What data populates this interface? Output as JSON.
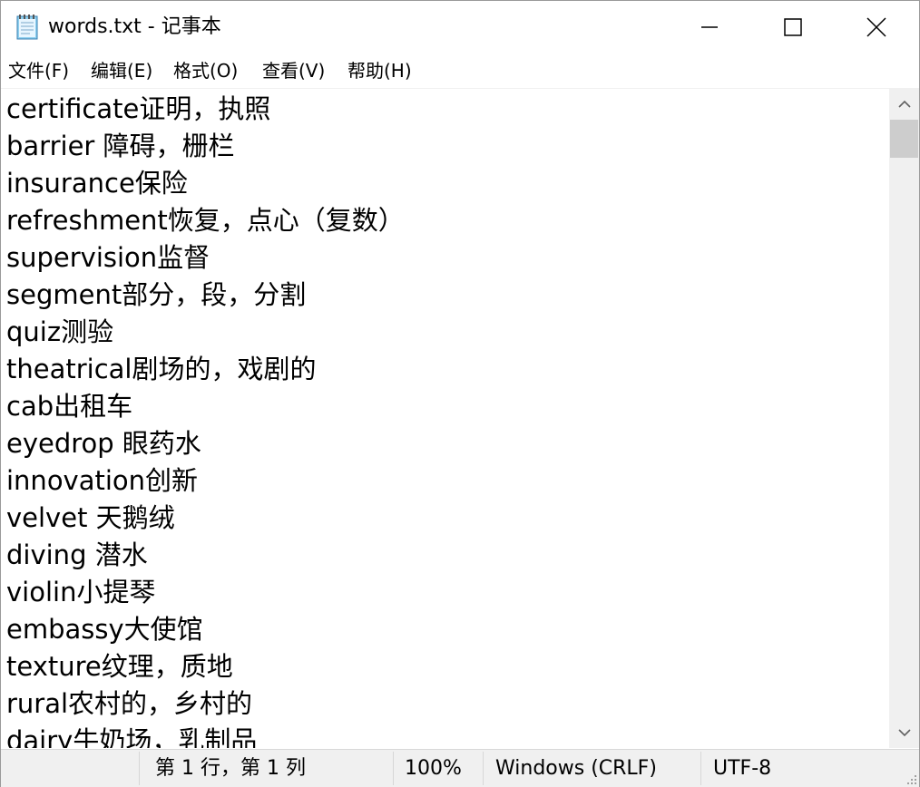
{
  "window": {
    "title": "words.txt - 记事本",
    "icon": "notepad-icon"
  },
  "menu": {
    "file": "文件(F)",
    "edit": "编辑(E)",
    "format": "格式(O)",
    "view": "查看(V)",
    "help": "帮助(H)"
  },
  "editor": {
    "lines": [
      "certificate证明，执照",
      "barrier 障碍，栅栏",
      "insurance保险",
      "refreshment恢复，点心（复数）",
      "supervision监督",
      "segment部分，段，分割",
      "quiz测验",
      "theatrical剧场的，戏剧的",
      "cab出租车",
      "eyedrop 眼药水",
      "innovation创新",
      "velvet 天鹅绒",
      "diving 潜水",
      "violin小提琴",
      "embassy大使馆",
      "texture纹理，质地",
      "rural农村的，乡村的",
      "dairy牛奶场，乳制品"
    ]
  },
  "status": {
    "position": "第 1 行，第 1 列",
    "zoom": "100%",
    "line_ending": "Windows (CRLF)",
    "encoding": "UTF-8"
  },
  "colors": {
    "scrollbar_track": "#f0f0f0",
    "scrollbar_thumb": "#cdcdcd",
    "statusbar_bg": "#f0f0f0"
  }
}
